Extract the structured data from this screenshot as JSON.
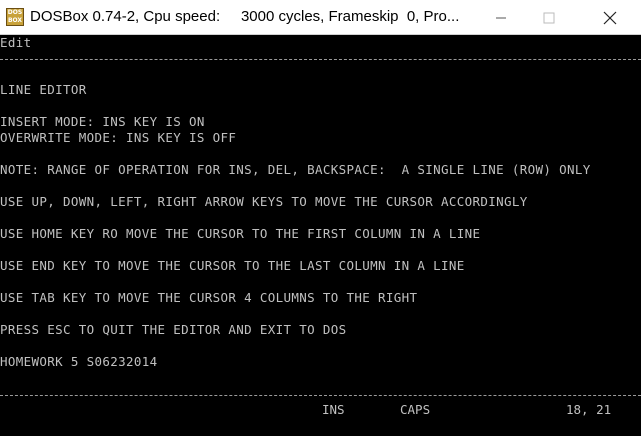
{
  "window": {
    "title": "DOSBox 0.74-2, Cpu speed:     3000 cycles, Frameskip  0, Pro...",
    "icon_name": "dosbox-icon",
    "icon_text_top": "DOS",
    "icon_text_bottom": "BOX"
  },
  "menu": {
    "edit_label": "Edit"
  },
  "content": {
    "heading": "LINE EDITOR",
    "insert_mode": "INSERT MODE: INS KEY IS ON",
    "overwrite_mode": "OVERWRITE MODE: INS KEY IS OFF",
    "note": "NOTE: RANGE OF OPERATION FOR INS, DEL, BACKSPACE:  A SINGLE LINE (ROW) ONLY",
    "arrows": "USE UP, DOWN, LEFT, RIGHT ARROW KEYS TO MOVE THE CURSOR ACCORDINGLY",
    "home": "USE HOME KEY RO MOVE THE CURSOR TO THE FIRST COLUMN IN A LINE",
    "end": "USE END KEY TO MOVE THE CURSOR TO THE LAST COLUMN IN A LINE",
    "tab": "USE TAB KEY TO MOVE THE CURSOR 4 COLUMNS TO THE RIGHT",
    "esc": "PRESS ESC TO QUIT THE EDITOR AND EXIT TO DOS",
    "homework": "HOMEWORK 5 S06232014"
  },
  "status_bar": {
    "ins": "INS",
    "caps": "CAPS",
    "cursor_position": "18, 21"
  },
  "colors": {
    "text": "#c0c0c0",
    "background": "#000000"
  }
}
